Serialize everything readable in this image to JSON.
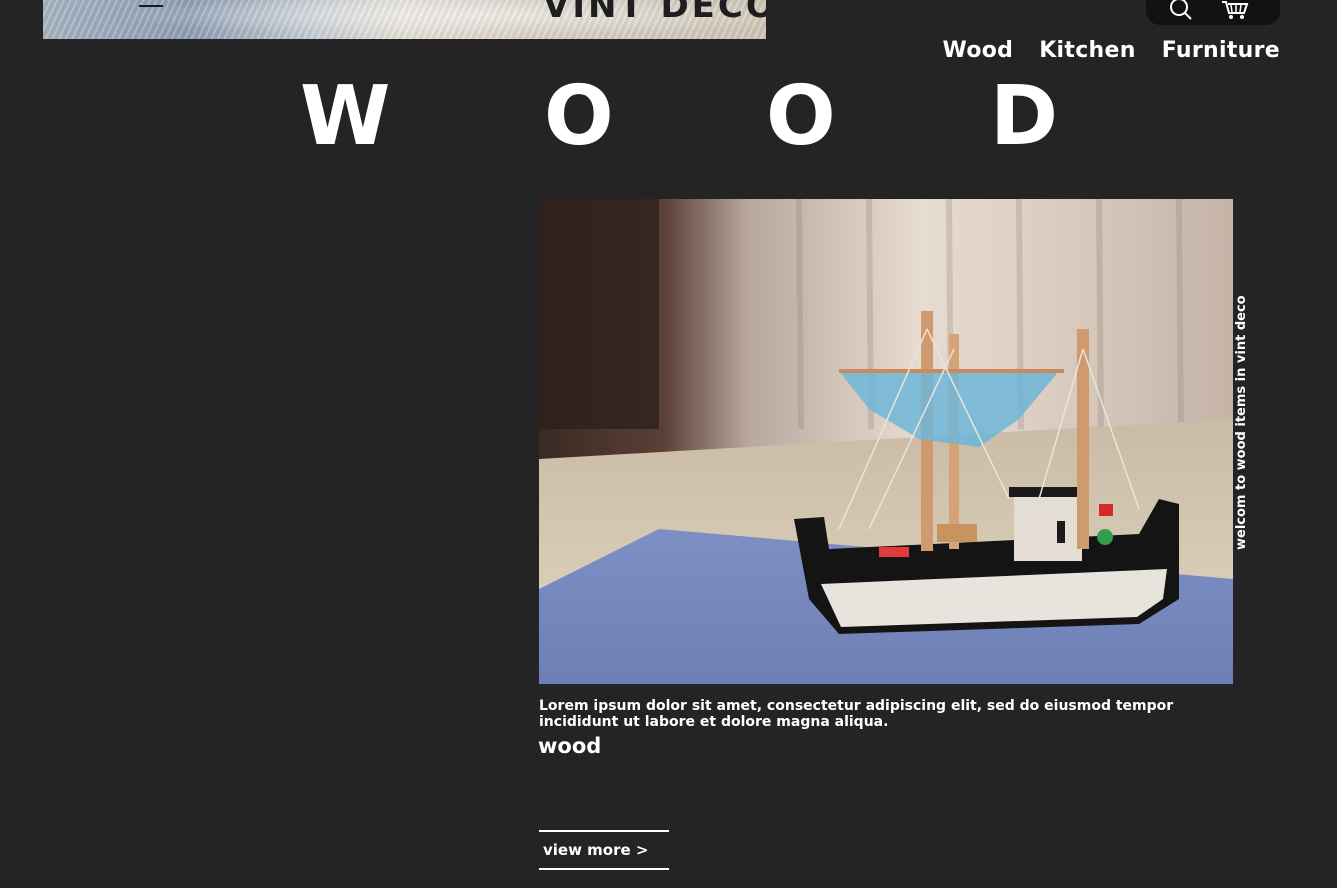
{
  "header": {
    "brand": "VINT DECO",
    "icons": [
      "menu-icon",
      "search-icon",
      "cart-icon"
    ]
  },
  "nav": {
    "items": [
      {
        "label": "Wood"
      },
      {
        "label": "Kitchen"
      },
      {
        "label": "Furniture"
      }
    ]
  },
  "hero": {
    "title_letters": [
      "W",
      "O",
      "O",
      "D"
    ],
    "side_text": "welcom to wood items in vint deco",
    "description": "Lorem ipsum dolor sit amet, consectetur adipiscing elit, sed do eiusmod tempor incididunt ut labore et dolore magna aliqua.",
    "category": "wood",
    "view_more_label": "view more >"
  },
  "colors": {
    "background": "#242424",
    "text": "#ffffff",
    "icon_pill": "#121212"
  }
}
